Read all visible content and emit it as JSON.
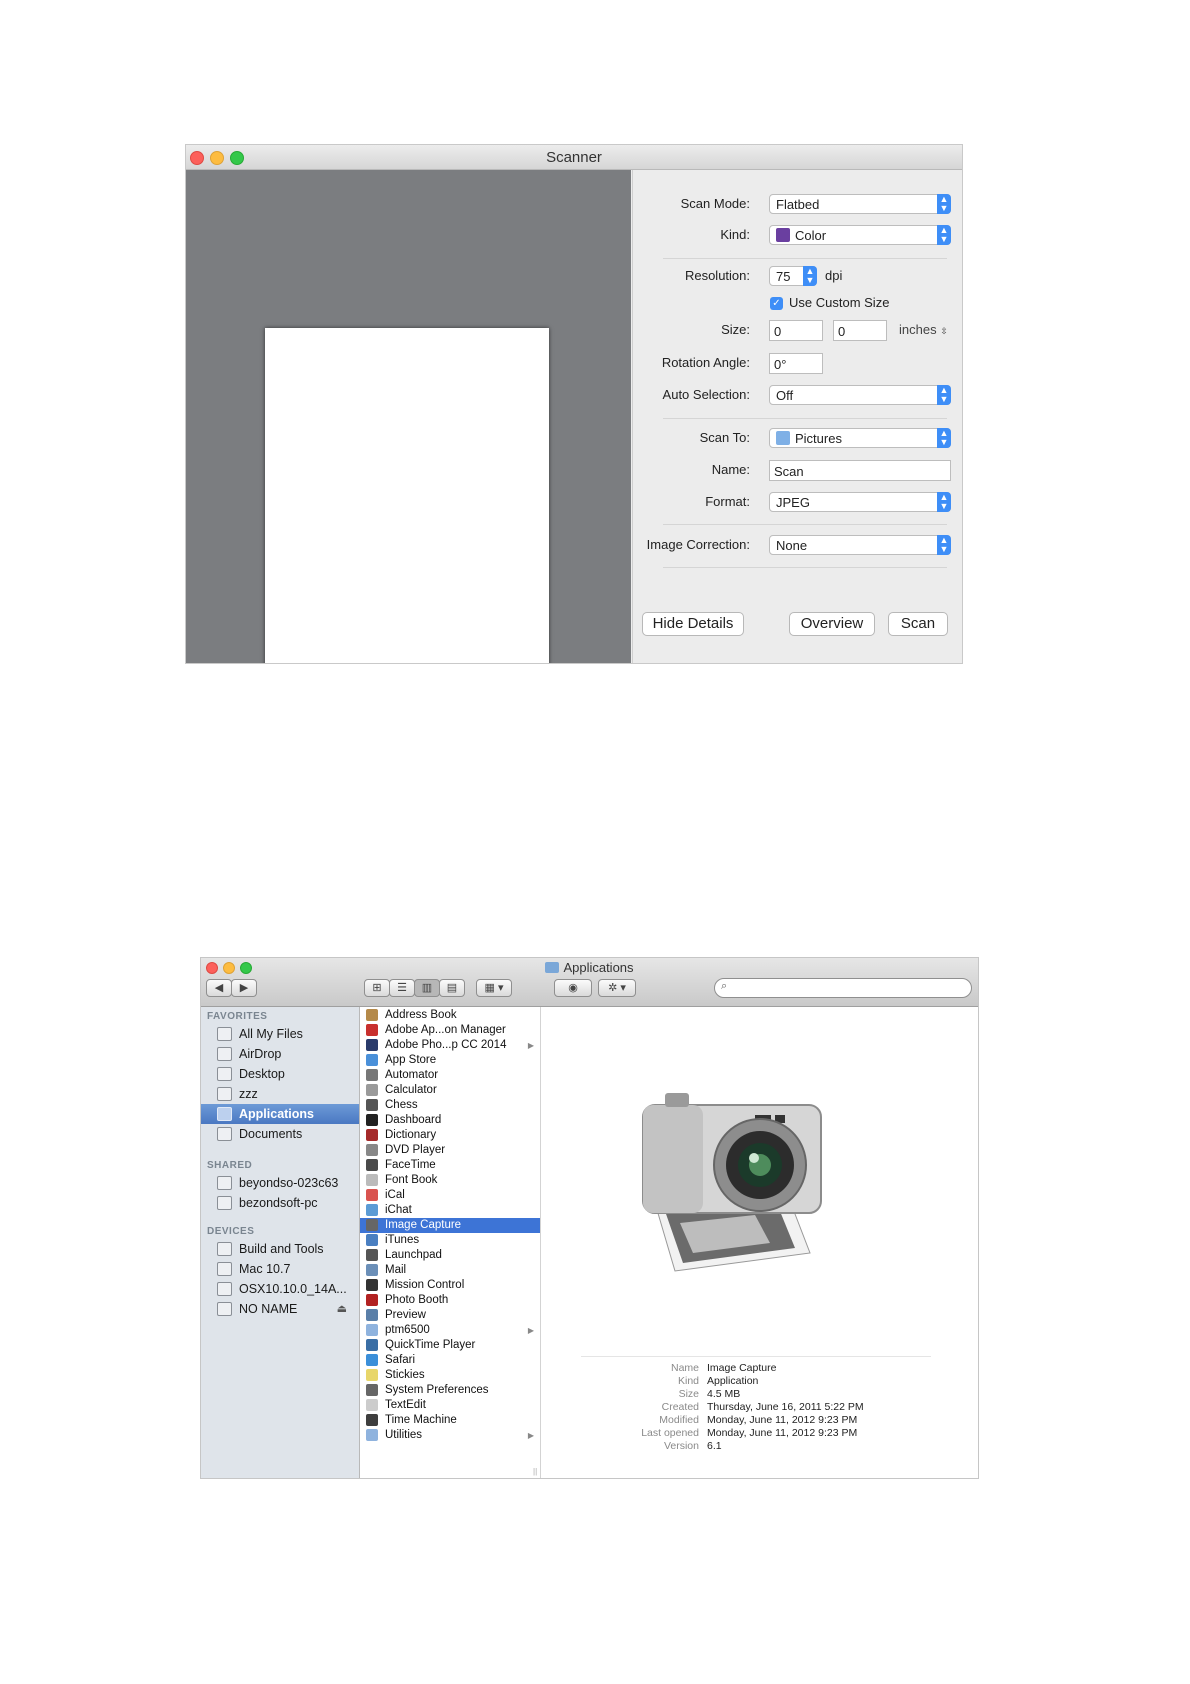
{
  "scanner": {
    "title": "Scanner",
    "scan_mode_label": "Scan Mode:",
    "scan_mode_value": "Flatbed",
    "kind_label": "Kind:",
    "kind_value": "Color",
    "resolution_label": "Resolution:",
    "resolution_value": "75",
    "resolution_unit": "dpi",
    "custom_size_label": "Use Custom Size",
    "custom_size_checked": true,
    "size_label": "Size:",
    "size_width": "0",
    "size_height": "0",
    "size_unit": "inches",
    "rotation_label": "Rotation Angle:",
    "rotation_value": "0°",
    "auto_selection_label": "Auto Selection:",
    "auto_selection_value": "Off",
    "scan_to_label": "Scan To:",
    "scan_to_value": "Pictures",
    "name_label": "Name:",
    "name_value": "Scan",
    "format_label": "Format:",
    "format_value": "JPEG",
    "image_correction_label": "Image Correction:",
    "image_correction_value": "None",
    "buttons": {
      "hide_details": "Hide Details",
      "overview": "Overview",
      "scan": "Scan"
    },
    "accent_color": "#3e8ef7"
  },
  "finder": {
    "title": "Applications",
    "sidebar": {
      "favorites_header": "FAVORITES",
      "favorites": [
        {
          "label": "All My Files",
          "icon": "all-files-icon"
        },
        {
          "label": "AirDrop",
          "icon": "airdrop-icon"
        },
        {
          "label": "Desktop",
          "icon": "desktop-icon"
        },
        {
          "label": "zzz",
          "icon": "home-icon"
        },
        {
          "label": "Applications",
          "icon": "applications-icon",
          "selected": true
        },
        {
          "label": "Documents",
          "icon": "documents-icon"
        }
      ],
      "shared_header": "SHARED",
      "shared": [
        {
          "label": "beyondso-023c63",
          "icon": "network-computer-icon"
        },
        {
          "label": "bezondsoft-pc",
          "icon": "network-computer-icon"
        }
      ],
      "devices_header": "DEVICES",
      "devices": [
        {
          "label": "Build and Tools",
          "icon": "disk-icon"
        },
        {
          "label": "Mac 10.7",
          "icon": "disk-icon"
        },
        {
          "label": "OSX10.10.0_14A...",
          "icon": "disk-icon"
        },
        {
          "label": "NO NAME",
          "icon": "disk-icon",
          "eject": "⏏"
        }
      ]
    },
    "apps": [
      {
        "label": "Address Book",
        "color": "#b58a4a"
      },
      {
        "label": "Adobe Ap...on Manager",
        "color": "#c8302e"
      },
      {
        "label": "Adobe Pho...p CC 2014",
        "color": "#2a3b6b",
        "folder": true
      },
      {
        "label": "App Store",
        "color": "#4a90d9"
      },
      {
        "label": "Automator",
        "color": "#777777"
      },
      {
        "label": "Calculator",
        "color": "#9a9a9a"
      },
      {
        "label": "Chess",
        "color": "#555555"
      },
      {
        "label": "Dashboard",
        "color": "#222222"
      },
      {
        "label": "Dictionary",
        "color": "#a52a2a"
      },
      {
        "label": "DVD Player",
        "color": "#888888"
      },
      {
        "label": "FaceTime",
        "color": "#4a4a4a"
      },
      {
        "label": "Font Book",
        "color": "#bbbbbb"
      },
      {
        "label": "iCal",
        "color": "#d9534f"
      },
      {
        "label": "iChat",
        "color": "#5b9bd5"
      },
      {
        "label": "Image Capture",
        "color": "#666666",
        "selected": true
      },
      {
        "label": "iTunes",
        "color": "#4a7fc1"
      },
      {
        "label": "Launchpad",
        "color": "#555555"
      },
      {
        "label": "Mail",
        "color": "#6b8fb8"
      },
      {
        "label": "Mission Control",
        "color": "#333333"
      },
      {
        "label": "Photo Booth",
        "color": "#b22222"
      },
      {
        "label": "Preview",
        "color": "#5a7fa8"
      },
      {
        "label": "ptm6500",
        "color": "#8fb3de",
        "folder": true
      },
      {
        "label": "QuickTime Player",
        "color": "#3a6ea5"
      },
      {
        "label": "Safari",
        "color": "#3b8fd9"
      },
      {
        "label": "Stickies",
        "color": "#e8d66a"
      },
      {
        "label": "System Preferences",
        "color": "#666666"
      },
      {
        "label": "TextEdit",
        "color": "#cccccc"
      },
      {
        "label": "Time Machine",
        "color": "#3e3e3e"
      },
      {
        "label": "Utilities",
        "color": "#8fb3de",
        "folder": true
      }
    ],
    "preview": {
      "icon": "image-capture-camera-icon",
      "meta": [
        {
          "key": "Name",
          "value": "Image Capture"
        },
        {
          "key": "Kind",
          "value": "Application"
        },
        {
          "key": "Size",
          "value": "4.5 MB"
        },
        {
          "key": "Created",
          "value": "Thursday, June 16, 2011 5:22 PM"
        },
        {
          "key": "Modified",
          "value": "Monday, June 11, 2012 9:23 PM"
        },
        {
          "key": "Last opened",
          "value": "Monday, June 11, 2012 9:23 PM"
        },
        {
          "key": "Version",
          "value": "6.1"
        }
      ]
    }
  }
}
